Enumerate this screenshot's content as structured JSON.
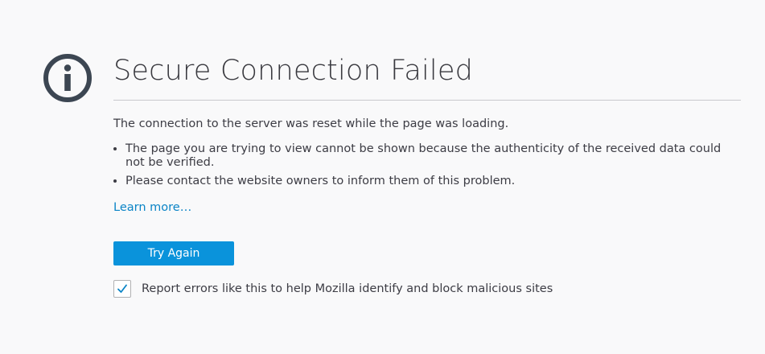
{
  "error": {
    "title": "Secure Connection Failed",
    "description": "The connection to the server was reset while the page was loading.",
    "reasons": [
      "The page you are trying to view cannot be shown because the authenticity of the received data could not be verified.",
      "Please contact the website owners to inform them of this problem."
    ],
    "learn_more": "Learn more…",
    "try_again": "Try Again",
    "report_label": "Report errors like this to help Mozilla identify and block malicious sites",
    "report_checked": true
  },
  "icons": {
    "info": "info-icon",
    "check": "checkmark-icon"
  },
  "colors": {
    "accent": "#0a93db",
    "link": "#0a84c6",
    "icon": "#3c4652"
  }
}
